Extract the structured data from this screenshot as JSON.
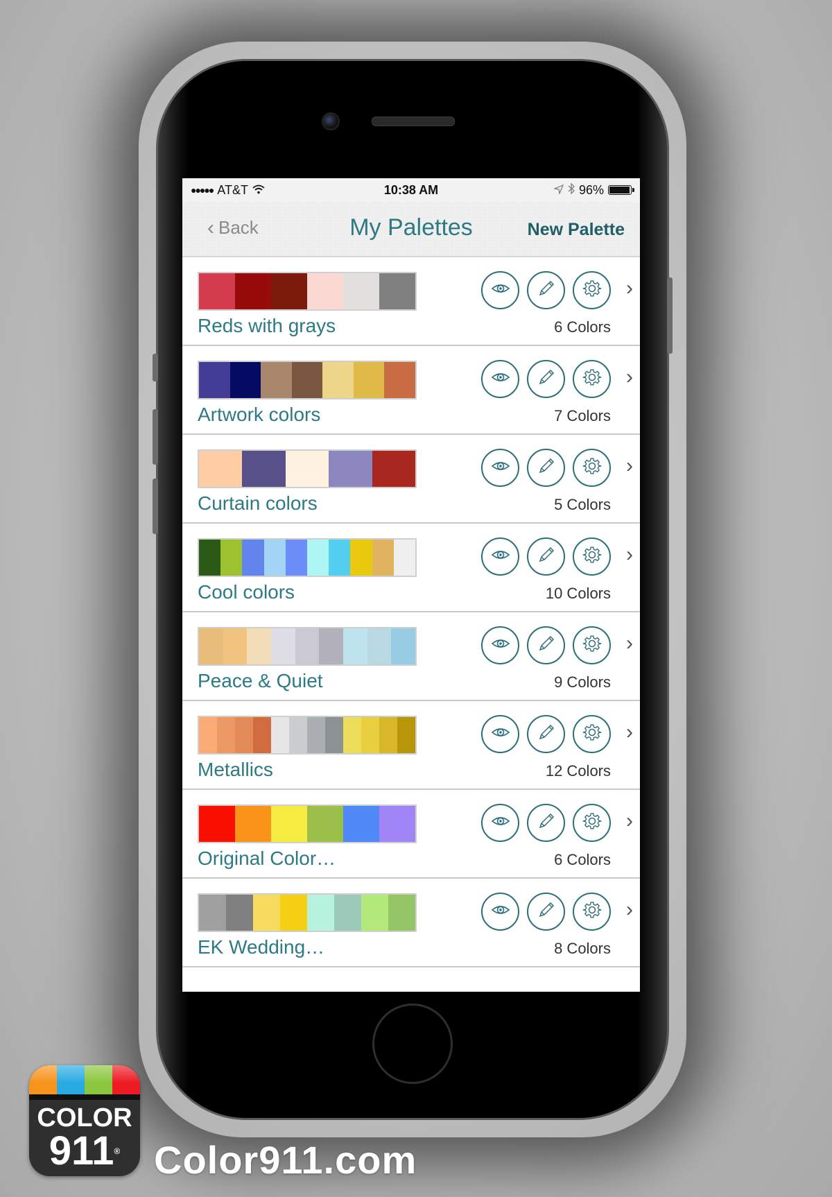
{
  "status_bar": {
    "carrier": "AT&T",
    "signal_dots": "●●●●●",
    "time": "10:38 AM",
    "battery_percent": "96%",
    "battery_level": 0.96
  },
  "nav": {
    "back_label": "Back",
    "title": "My Palettes",
    "new_label": "New Palette"
  },
  "palettes": [
    {
      "name": "Reds with grays",
      "count": "6 Colors",
      "colors": [
        "#d43c4e",
        "#980b0b",
        "#7c1a0c",
        "#fcd8d3",
        "#e1e0df",
        "#808080"
      ]
    },
    {
      "name": "Artwork colors",
      "count": "7 Colors",
      "colors": [
        "#433d96",
        "#050b63",
        "#a9876d",
        "#7a5740",
        "#edd58a",
        "#dfba49",
        "#c86c44"
      ]
    },
    {
      "name": "Curtain colors",
      "count": "5 Colors",
      "colors": [
        "#ffcda3",
        "#575089",
        "#fff0e0",
        "#8c87bf",
        "#a8271f"
      ]
    },
    {
      "name": "Cool colors",
      "count": "10 Colors",
      "colors": [
        "#2b5a17",
        "#9ec12f",
        "#6185ec",
        "#a3d4f6",
        "#6c8cf8",
        "#aef6f5",
        "#53d0ef",
        "#e8c90d",
        "#e2b35f",
        "#f0f0f0"
      ]
    },
    {
      "name": "Peace & Quiet",
      "count": "9 Colors",
      "colors": [
        "#e8bc79",
        "#f2c37f",
        "#f3dcb8",
        "#dedde6",
        "#cbcad4",
        "#b2b0bb",
        "#bfe2ef",
        "#b9d9e4",
        "#97cde4"
      ]
    },
    {
      "name": "Metallics",
      "count": "12 Colors",
      "colors": [
        "#fdab76",
        "#ec9964",
        "#e38b57",
        "#d06c40",
        "#e5e6e5",
        "#cacdce",
        "#abafb4",
        "#8c9194",
        "#ebdd59",
        "#e8cf3e",
        "#d9b72a",
        "#b79609"
      ]
    },
    {
      "name": "Original Color…",
      "count": "6 Colors",
      "colors": [
        "#f80f00",
        "#f99319",
        "#f7ec41",
        "#9cbf49",
        "#4f89f8",
        "#a184f6"
      ]
    },
    {
      "name": "EK Wedding…",
      "count": "8 Colors",
      "colors": [
        "#a0a0a0",
        "#808080",
        "#f6db5f",
        "#f5cf14",
        "#b6f2dd",
        "#9dc9ba",
        "#b3e97b",
        "#94c566"
      ]
    }
  ],
  "row_actions": {
    "view_icon": "eye-icon",
    "edit_icon": "pencil-icon",
    "settings_icon": "gear-icon",
    "open_icon": "chevron-right-icon"
  },
  "branding": {
    "logo_word": "COLOR",
    "logo_number": "911",
    "registered": "®",
    "logo_stripe_colors": [
      "#f7941d",
      "#29abe2",
      "#8cc63f",
      "#ed1c24"
    ],
    "site": "Color911.com"
  },
  "theme": {
    "accent": "#2d7a84",
    "accent_dark": "#1f5e66"
  }
}
